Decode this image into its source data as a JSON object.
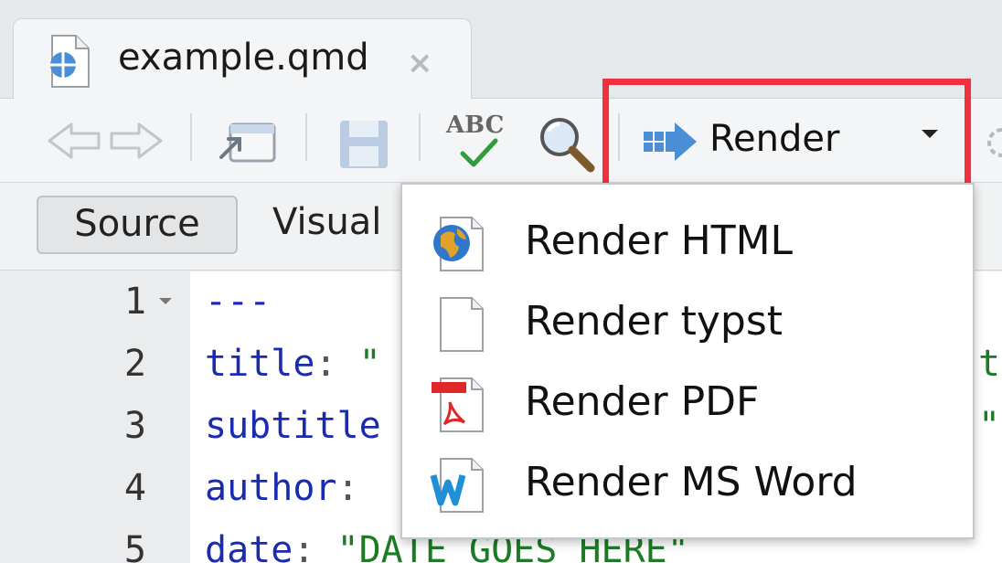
{
  "tab": {
    "title": "example.qmd",
    "close_glyph": "×"
  },
  "toolbar": {
    "back_icon": "back-arrow-icon",
    "forward_icon": "forward-arrow-icon",
    "show_in_window_icon": "popout-window-icon",
    "save_icon": "save-disk-icon",
    "spellcheck_label": "ABC",
    "spellcheck_icon": "spellcheck-icon",
    "find_icon": "magnifier-icon",
    "render_label": "Render",
    "render_icon": "render-arrow-icon",
    "highlight_color": "#f0303c"
  },
  "modes": {
    "source_label": "Source",
    "visual_label": "Visual"
  },
  "editor": {
    "lines": [
      {
        "number": "1",
        "key": "---",
        "sep": "",
        "value": ""
      },
      {
        "number": "2",
        "key": "title",
        "sep": ": ",
        "value": "\""
      },
      {
        "number": "3",
        "key": "subtitle",
        "sep": "",
        "value": ""
      },
      {
        "number": "4",
        "key": "author",
        "sep": ": ",
        "value": ""
      },
      {
        "number": "5",
        "key": "date",
        "sep": ": ",
        "value": "\"DATE GOES HERE\""
      }
    ],
    "overflow_right": {
      "line2": "t",
      "line3": "\""
    }
  },
  "render_menu": {
    "items": [
      {
        "label": "Render HTML",
        "icon": "globe-document-icon"
      },
      {
        "label": "Render typst",
        "icon": "blank-document-icon"
      },
      {
        "label": "Render PDF",
        "icon": "pdf-document-icon"
      },
      {
        "label": "Render MS Word",
        "icon": "word-document-icon"
      }
    ]
  }
}
